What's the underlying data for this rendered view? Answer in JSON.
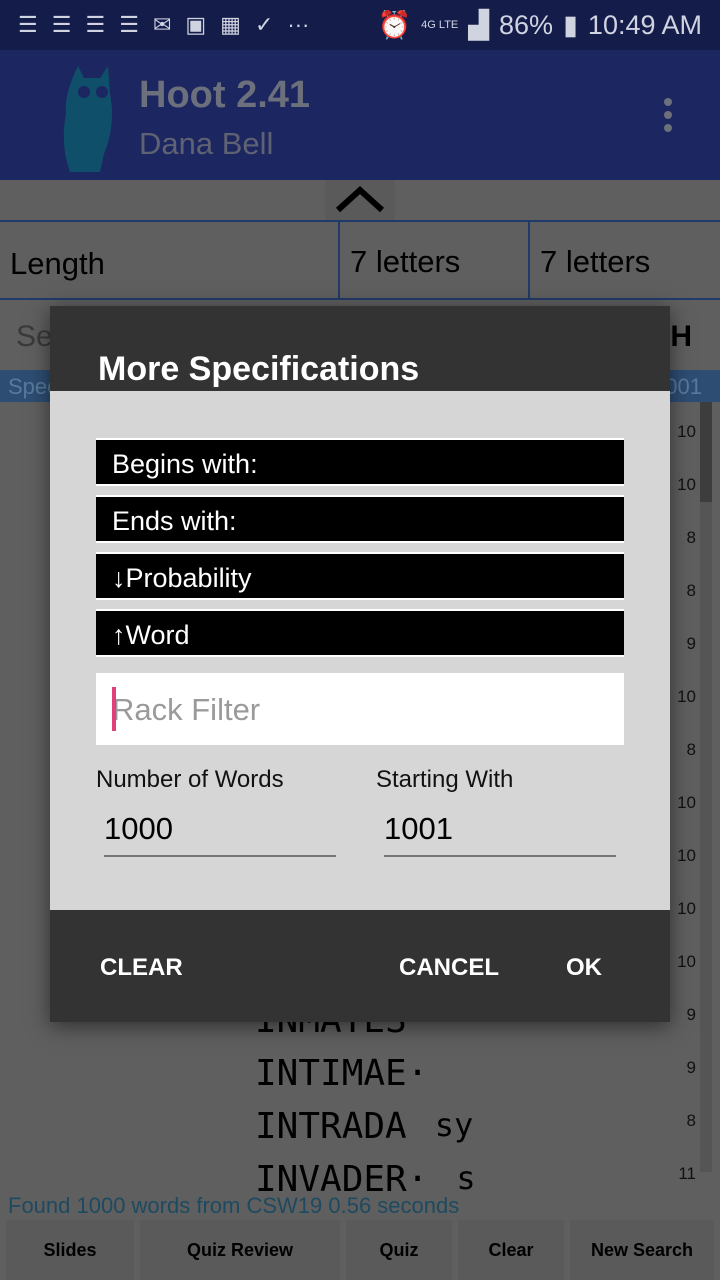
{
  "status": {
    "icons": [
      "notes-icon",
      "notes-icon",
      "notes-icon",
      "notes-icon",
      "mail-icon",
      "image-icon",
      "ifttt-icon",
      "check-icon",
      "more-icon"
    ],
    "battery": "86%",
    "time": "10:49 AM",
    "network": "4G LTE"
  },
  "app": {
    "title": "Hoot 2.41",
    "subtitle": "Dana Bell"
  },
  "search": {
    "length_label": "Length",
    "min": "7 letters",
    "max": "7 letters",
    "row2_partial": "Se",
    "row2_right": "H",
    "spec_partial": "Spec",
    "spec_right": "001"
  },
  "list": {
    "scores": [
      "10",
      "10",
      "8",
      "8",
      "9",
      "10",
      "8",
      "10",
      "10",
      "10",
      "10",
      "9",
      "9",
      "8",
      "11"
    ],
    "words": [
      {
        "word": "INMATES",
        "ext": ""
      },
      {
        "word": "INTIMAE·",
        "ext": ""
      },
      {
        "word": "INTRADA",
        "ext": "sy"
      },
      {
        "word": "INVADER·",
        "ext": "s"
      }
    ]
  },
  "found": "Found 1000 words from CSW19   0.56 seconds",
  "buttons": [
    "Slides",
    "Quiz Review",
    "Quiz",
    "Clear",
    "New Search"
  ],
  "dialog": {
    "title": "More Specifications",
    "begins": "Begins with:",
    "ends": "Ends with:",
    "probability": "↓Probability",
    "word": "↑Word",
    "rack_placeholder": "Rack Filter",
    "num_words_label": "Number of Words",
    "num_words": "1000",
    "starting_label": "Starting With",
    "starting": "1001",
    "clear": "CLEAR",
    "cancel": "CANCEL",
    "ok": "OK"
  }
}
